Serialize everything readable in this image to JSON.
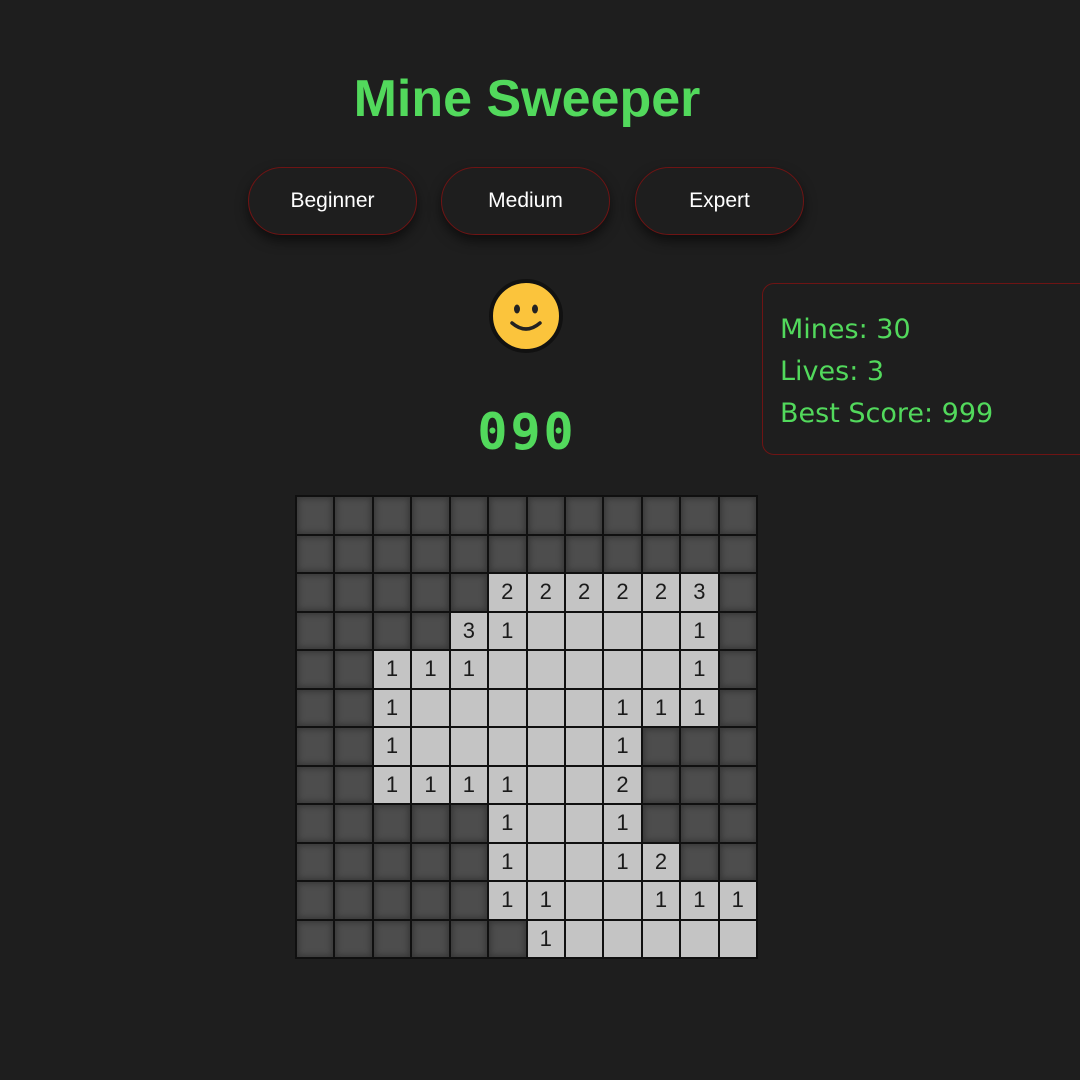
{
  "title": "Mine Sweeper",
  "levels": [
    {
      "label": "Beginner"
    },
    {
      "label": "Medium"
    },
    {
      "label": "Expert"
    }
  ],
  "status_face": "smiley-face",
  "timer": "090",
  "stats": {
    "mines": "Mines: 30",
    "lives": "Lives: 3",
    "best_score": "Best Score: 999"
  },
  "colors": {
    "accent": "#52d95c",
    "border_red": "#6e1414",
    "background": "#1e1e1e",
    "hidden_cell": "#4d4d4d",
    "revealed_cell": "#c4c4c4"
  },
  "board": {
    "rows": 12,
    "cols": 12,
    "legend": "H = hidden cell, blank = revealed empty, digit = revealed neighbor count",
    "cells": [
      [
        "H",
        "H",
        "H",
        "H",
        "H",
        "H",
        "H",
        "H",
        "H",
        "H",
        "H",
        "H"
      ],
      [
        "H",
        "H",
        "H",
        "H",
        "H",
        "H",
        "H",
        "H",
        "H",
        "H",
        "H",
        "H"
      ],
      [
        "H",
        "H",
        "H",
        "H",
        "H",
        "2",
        "2",
        "2",
        "2",
        "2",
        "3",
        "H"
      ],
      [
        "H",
        "H",
        "H",
        "H",
        "3",
        "1",
        "",
        "",
        "",
        "",
        "1",
        "H"
      ],
      [
        "H",
        "H",
        "1",
        "1",
        "1",
        "",
        "",
        "",
        "",
        "",
        "1",
        "H"
      ],
      [
        "H",
        "H",
        "1",
        "",
        "",
        "",
        "",
        "",
        "1",
        "1",
        "1",
        "H"
      ],
      [
        "H",
        "H",
        "1",
        "",
        "",
        "",
        "",
        "",
        "1",
        "H",
        "H",
        "H"
      ],
      [
        "H",
        "H",
        "1",
        "1",
        "1",
        "1",
        "",
        "",
        "2",
        "H",
        "H",
        "H"
      ],
      [
        "H",
        "H",
        "H",
        "H",
        "H",
        "1",
        "",
        "",
        "1",
        "H",
        "H",
        "H"
      ],
      [
        "H",
        "H",
        "H",
        "H",
        "H",
        "1",
        "",
        "",
        "1",
        "2",
        "H",
        "H"
      ],
      [
        "H",
        "H",
        "H",
        "H",
        "H",
        "1",
        "1",
        "",
        "",
        "1",
        "1",
        "1"
      ],
      [
        "H",
        "H",
        "H",
        "H",
        "H",
        "H",
        "1",
        "",
        "",
        "",
        "",
        ""
      ]
    ]
  }
}
